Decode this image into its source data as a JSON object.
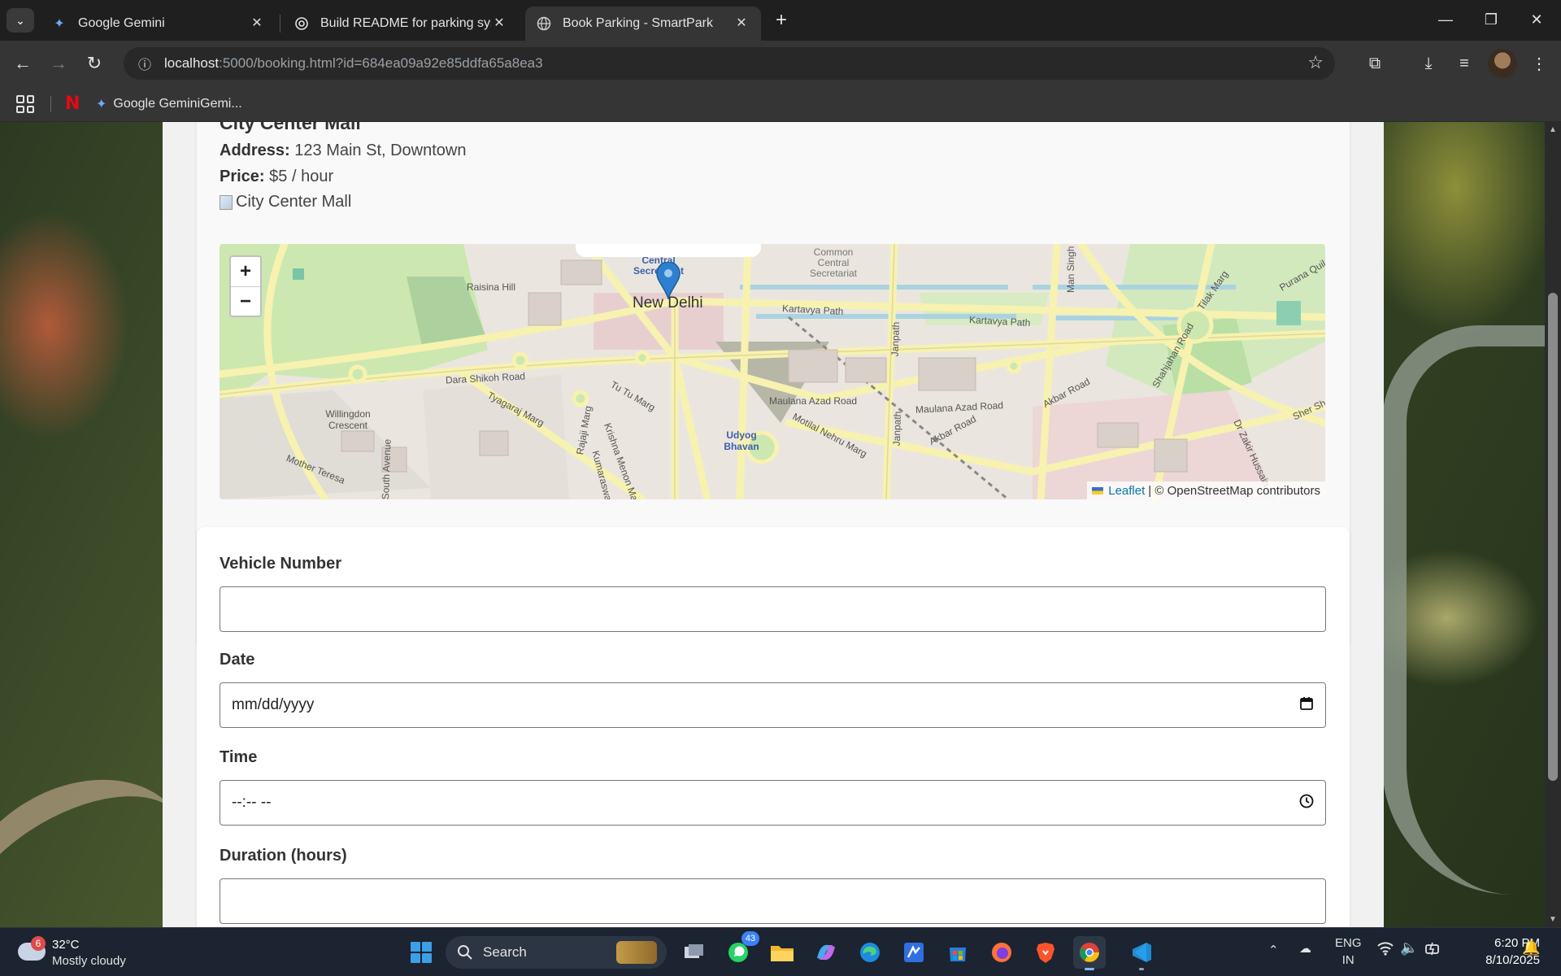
{
  "browser": {
    "tabs": [
      {
        "title": "Google Gemini",
        "icon": "gemini-icon",
        "active": false
      },
      {
        "title": "Build README for parking syste",
        "icon": "chatgpt-icon",
        "active": false
      },
      {
        "title": "Book Parking - SmartPark",
        "icon": "globe-icon",
        "active": true
      }
    ],
    "url_host": "localhost",
    "url_rest": ":5000/booking.html?id=684ea09a92e85ddfa65a8ea3",
    "bookmarks": [
      {
        "label": "",
        "icon": "netflix-icon"
      },
      {
        "label": "Google GeminiGemi...",
        "icon": "gemini-icon"
      }
    ]
  },
  "lot": {
    "name": "City Center Mall",
    "address_label": "Address:",
    "address": "123 Main St, Downtown",
    "price_label": "Price:",
    "price": "$5 / hour",
    "image_alt": "City Center Mall"
  },
  "map": {
    "city_label": "New Delhi",
    "labels": [
      "Raisina Hill",
      "Central Secretariat",
      "Common Central Secretariat",
      "Kartavya Path",
      "Kartavya Path",
      "Dara Shikoh Road",
      "Maulana Azad Road",
      "Maulana Azad Road",
      "Willingdon Crescent",
      "Tyagaraj Marg",
      "Tu Tu Marg",
      "Rajaji Marg",
      "Udyog Bhavan",
      "Motilal Nehru Marg",
      "Janpath",
      "Janpath",
      "Akbar Road",
      "Akbar Road",
      "Man Singh Road",
      "Shahjahan Road",
      "Tilak Marg",
      "Purana Quila",
      "South Avenue",
      "Mother Teresa",
      "Krishna Menon Marg",
      "Kumaraswami",
      "Dr Zakir Hussain",
      "Sher Shah"
    ],
    "zoom_in": "+",
    "zoom_out": "−",
    "attribution_link": "Leaflet",
    "attribution_text": "| © OpenStreetMap contributors"
  },
  "form": {
    "vehicle_label": "Vehicle Number",
    "vehicle_value": "",
    "date_label": "Date",
    "date_placeholder": "mm/dd/yyyy",
    "time_label": "Time",
    "time_placeholder": "--:-- --",
    "duration_label": "Duration (hours)",
    "duration_value": ""
  },
  "taskbar": {
    "weather_temp": "32°C",
    "weather_desc": "Mostly cloudy",
    "weather_badge": "6",
    "search_label": "Search",
    "whatsapp_badge": "43",
    "lang_top": "ENG",
    "lang_bottom": "IN",
    "time": "6:20 PM",
    "date": "8/10/2025"
  }
}
